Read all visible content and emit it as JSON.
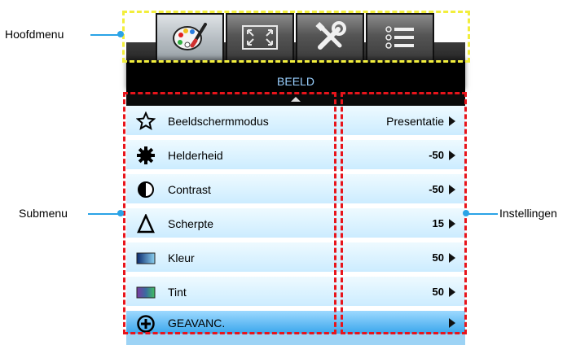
{
  "annotations": {
    "main_menu": "Hoofdmenu",
    "submenu": "Submenu",
    "settings": "Instellingen"
  },
  "tabs": [
    {
      "name": "picture",
      "icon": "palette-icon",
      "active": true
    },
    {
      "name": "display",
      "icon": "aspect-ratio-icon",
      "active": false
    },
    {
      "name": "setup",
      "icon": "tools-icon",
      "active": false
    },
    {
      "name": "options",
      "icon": "list-icon",
      "active": false
    }
  ],
  "menu": {
    "title": "BEELD",
    "items": [
      {
        "icon": "star-icon",
        "label": "Beeldschermmodus",
        "value": "Presentatie"
      },
      {
        "icon": "gear-icon",
        "label": "Helderheid",
        "value": "-50"
      },
      {
        "icon": "contrast-icon",
        "label": "Contrast",
        "value": "-50"
      },
      {
        "icon": "triangle-icon",
        "label": "Scherpte",
        "value": "15"
      },
      {
        "icon": "color-swatch-icon",
        "label": "Kleur",
        "value": "50"
      },
      {
        "icon": "tint-swatch-icon",
        "label": "Tint",
        "value": "50"
      },
      {
        "icon": "plus-circle-icon",
        "label": "GEAVANC.",
        "value": "",
        "selected": true
      }
    ]
  },
  "colors": {
    "callout_main": "#f2ee3c",
    "callout_sub": "#e8141b",
    "leader_line": "#2aa3e6",
    "title_text": "#9ad0ff"
  }
}
